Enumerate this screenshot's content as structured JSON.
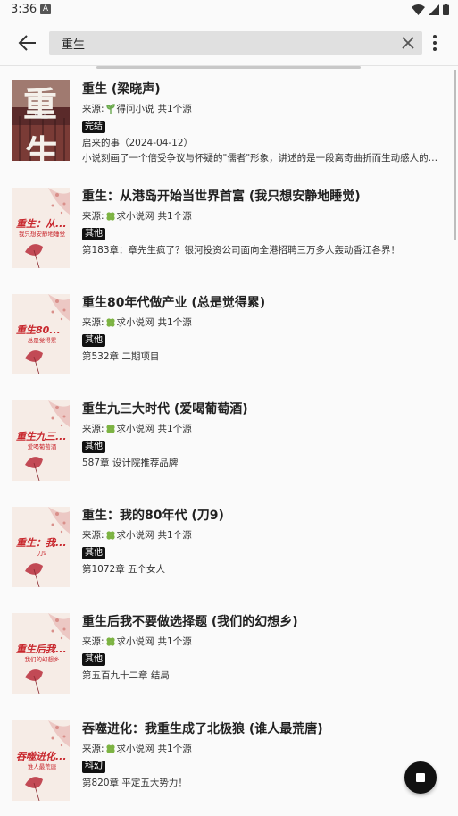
{
  "status_bar": {
    "time": "3:36",
    "badge": "A"
  },
  "toolbar": {
    "search_value": "重生"
  },
  "source_prefix": "来源:",
  "results": [
    {
      "title": "重生 (梁晓声)",
      "source": "得问小说",
      "count": "共1个源",
      "tag": "完结",
      "latest": "启来的事（2024-04-12）",
      "intro": "小说刻画了一个倍受争议与怀疑的\"儒者\"形象，讲述的是一段离奇曲折而生动感人的抗日…",
      "cover_title": "",
      "cover_author": ""
    },
    {
      "title": "重生：从港岛开始当世界首富 (我只想安静地睡觉)",
      "source": "求小说网",
      "count": "共1个源",
      "tag": "其他",
      "latest": "第183章：章先生疯了？银河投资公司面向全港招聘三万多人轰动香江各界！",
      "cover_title": "重生：从...",
      "cover_author": "我只想安静地睡觉"
    },
    {
      "title": "重生80年代做产业 (总是觉得累)",
      "source": "求小说网",
      "count": "共1个源",
      "tag": "其他",
      "latest": "第532章 二期项目",
      "cover_title": "重生80...",
      "cover_author": "总是觉得累"
    },
    {
      "title": "重生九三大时代 (爱喝葡萄酒)",
      "source": "求小说网",
      "count": "共1个源",
      "tag": "其他",
      "latest": "587章 设计院推荐品牌",
      "cover_title": "重生九三...",
      "cover_author": "爱喝葡萄酒"
    },
    {
      "title": "重生：我的80年代 (刀9)",
      "source": "求小说网",
      "count": "共1个源",
      "tag": "其他",
      "latest": "第1072章 五个女人",
      "cover_title": "重生：我...",
      "cover_author": "刀9"
    },
    {
      "title": "重生后我不要做选择题 (我们的幻想乡)",
      "source": "求小说网",
      "count": "共1个源",
      "tag": "其他",
      "latest": "第五百九十二章 结局",
      "cover_title": "重生后我...",
      "cover_author": "我们的幻想乡"
    },
    {
      "title": "吞噬进化：我重生成了北极狼 (谁人最荒唐)",
      "source": "求小说网",
      "count": "共1个源",
      "tag": "科幻",
      "latest": "第820章 平定五大势力！",
      "cover_title": "吞噬进化...",
      "cover_author": "谁人最荒唐"
    }
  ],
  "first_cover": {
    "big_char_1": "重",
    "small_text": "重生",
    "big_char_2": "生"
  },
  "icons": {
    "back": "arrow-left-icon",
    "clear": "close-icon",
    "more": "more-vert-icon",
    "source": "clover-icon",
    "fab": "stop-icon"
  },
  "colors": {
    "accent_red": "#c8282e",
    "tag_bg": "#111111",
    "search_bg": "#e0e0e0"
  }
}
